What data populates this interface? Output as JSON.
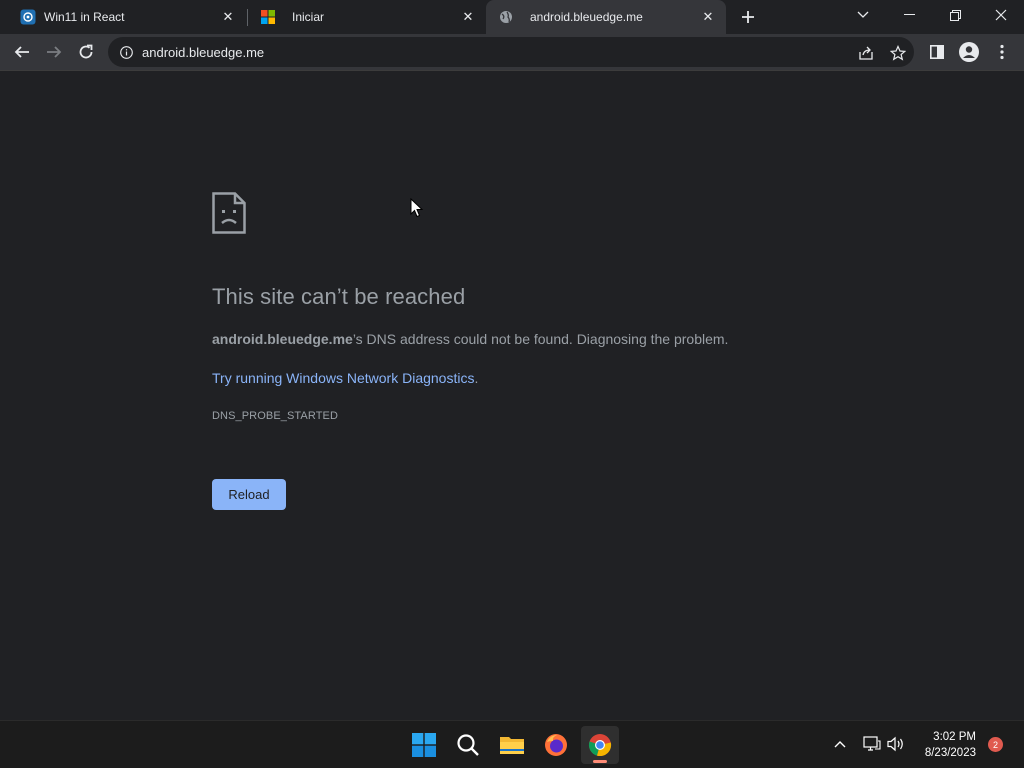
{
  "tabs": [
    {
      "title": "Win11 in React",
      "favicon": "react-app-icon"
    },
    {
      "title": "Iniciar",
      "favicon": "windows-logo-icon"
    },
    {
      "title": "android.bleuedge.me",
      "favicon": "globe-icon"
    }
  ],
  "address_bar": {
    "url": "android.bleuedge.me"
  },
  "error_page": {
    "title": "This site can’t be reached",
    "host": "android.bleuedge.me",
    "message_suffix": "’s DNS address could not be found. Diagnosing the problem.",
    "link_text": "Try running Windows Network Diagnostics",
    "link_period": ".",
    "error_code": "DNS_PROBE_STARTED",
    "reload_label": "Reload"
  },
  "taskbar": {
    "time": "3:02 PM",
    "date": "8/23/2023",
    "notification_count": "2",
    "apps": [
      "start-icon",
      "search-icon",
      "file-explorer-icon",
      "firefox-icon",
      "chrome-icon"
    ]
  },
  "colors": {
    "page_bg": "#202124",
    "toolbar_bg": "#35363a",
    "link": "#8ab4f8",
    "text_muted": "#9aa0a6",
    "taskbar_bg": "#1c1c1c"
  }
}
